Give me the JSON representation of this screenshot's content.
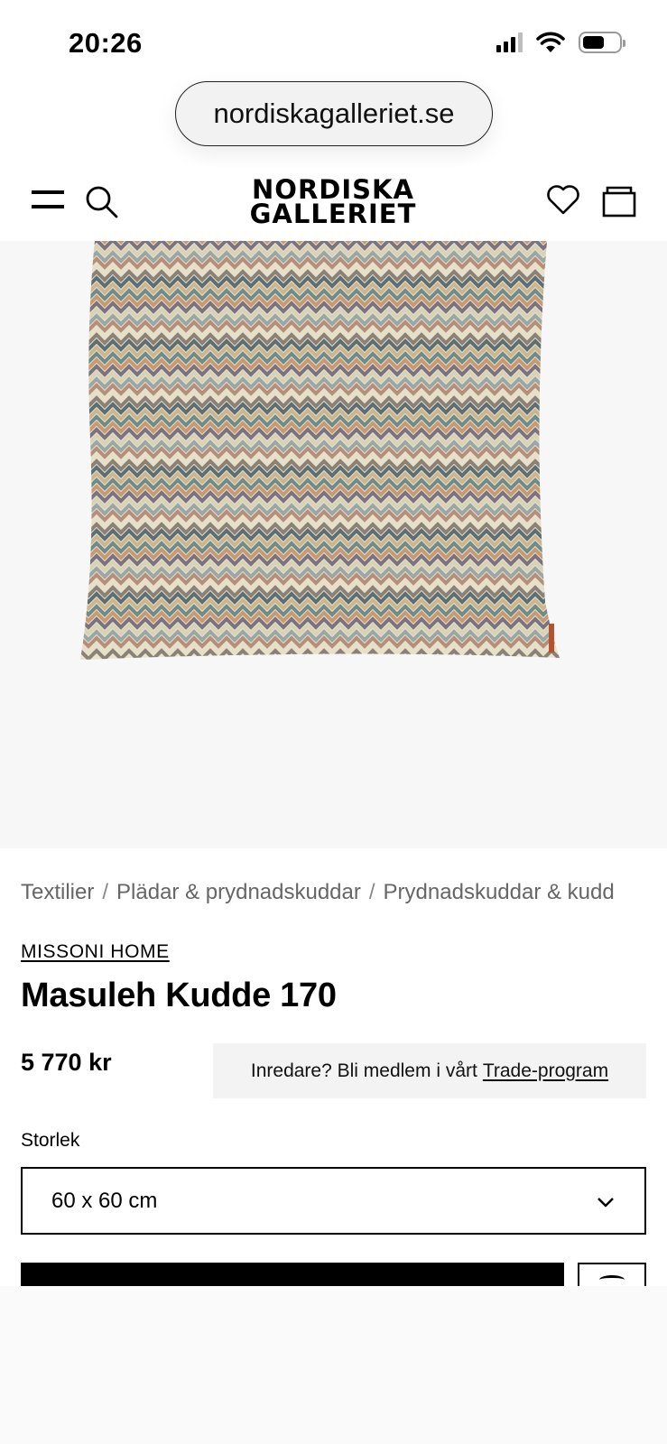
{
  "status_bar": {
    "time": "20:26"
  },
  "browser": {
    "url": "nordiskagalleriet.se"
  },
  "header": {
    "logo_line1": "NORDISKA",
    "logo_line2": "GALLERIET"
  },
  "breadcrumb": {
    "items": [
      "Textilier",
      "Plädar & prydnadskuddar",
      "Prydnadskuddar & kudd"
    ],
    "separator": "/"
  },
  "product": {
    "brand": "MISSONI HOME",
    "title": "Masuleh Kudde 170",
    "price": "5 770 kr",
    "trade_text": "Inredare? Bli medlem i vårt",
    "trade_link": "Trade-program",
    "size_label": "Storlek",
    "size_selected": "60 x 60 cm"
  },
  "colors": {
    "pattern": [
      "#6f8c8a",
      "#c79a74",
      "#7a7480",
      "#d8d2b6",
      "#9aa7a4",
      "#b58f7a",
      "#e7e0c8",
      "#8a8276",
      "#5e6f74",
      "#cbb68f"
    ],
    "tag": "#b5532f"
  }
}
